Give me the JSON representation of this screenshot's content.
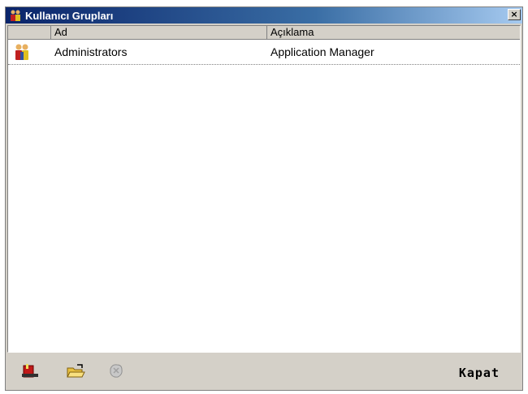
{
  "window": {
    "title": "Kullanıcı Grupları",
    "close_label": "×"
  },
  "list": {
    "columns": [
      {
        "key": "icon",
        "label": ""
      },
      {
        "key": "ad",
        "label": "Ad"
      },
      {
        "key": "aciklama",
        "label": "Açıklama"
      }
    ],
    "rows": [
      {
        "icon": "user-group-icon",
        "ad": "Administrators",
        "aciklama": "Application Manager"
      }
    ]
  },
  "toolbar": {
    "add_icon": "add-group-icon",
    "open_icon": "open-folder-icon",
    "delete_icon": "delete-icon",
    "close_label": "Kapat"
  },
  "colors": {
    "titlebar_start": "#0a246a",
    "titlebar_end": "#a6caf0",
    "window_bg": "#d4d0c8"
  }
}
